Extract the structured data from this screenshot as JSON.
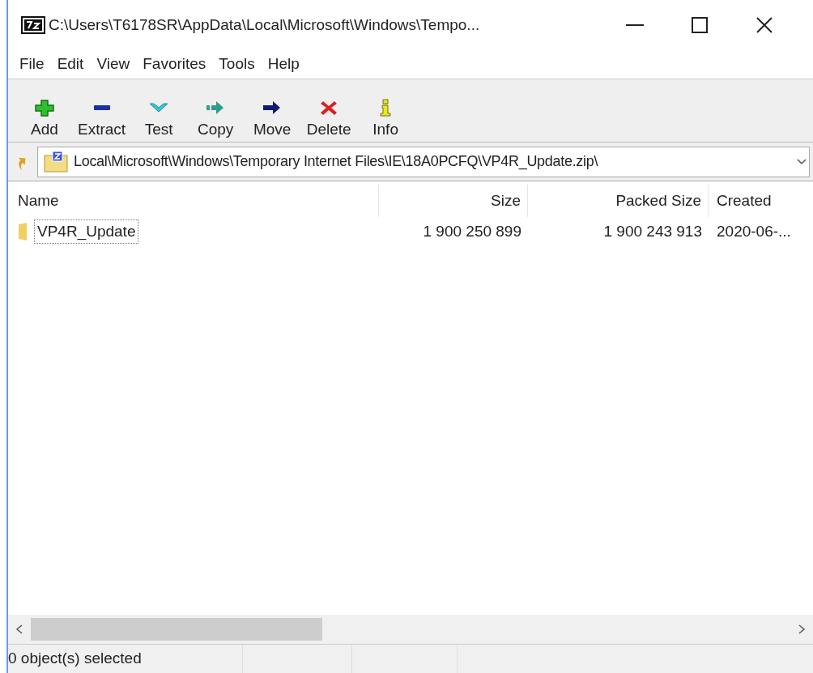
{
  "window": {
    "title": "C:\\Users\\T6178SR\\AppData\\Local\\Microsoft\\Windows\\Tempo..."
  },
  "menu": [
    "File",
    "Edit",
    "View",
    "Favorites",
    "Tools",
    "Help"
  ],
  "toolbar": [
    {
      "kind": "add",
      "label": "Add"
    },
    {
      "kind": "extract",
      "label": "Extract"
    },
    {
      "kind": "test",
      "label": "Test"
    },
    {
      "kind": "copy",
      "label": "Copy"
    },
    {
      "kind": "move",
      "label": "Move"
    },
    {
      "kind": "delete",
      "label": "Delete"
    },
    {
      "kind": "info",
      "label": "Info"
    }
  ],
  "address": {
    "value": "Local\\Microsoft\\Windows\\Temporary Internet Files\\IE\\18A0PCFQ\\VP4R_Update.zip\\"
  },
  "table": {
    "columns": [
      "Name",
      "Size",
      "Packed Size",
      "Created"
    ],
    "rows": [
      {
        "name": "VP4R_Update",
        "size": "1 900 250 899",
        "packed_size": "1 900 243 913",
        "created": "2020-06-...",
        "focused": true
      }
    ]
  },
  "status_bar": {
    "text": "0 object(s) selected"
  }
}
